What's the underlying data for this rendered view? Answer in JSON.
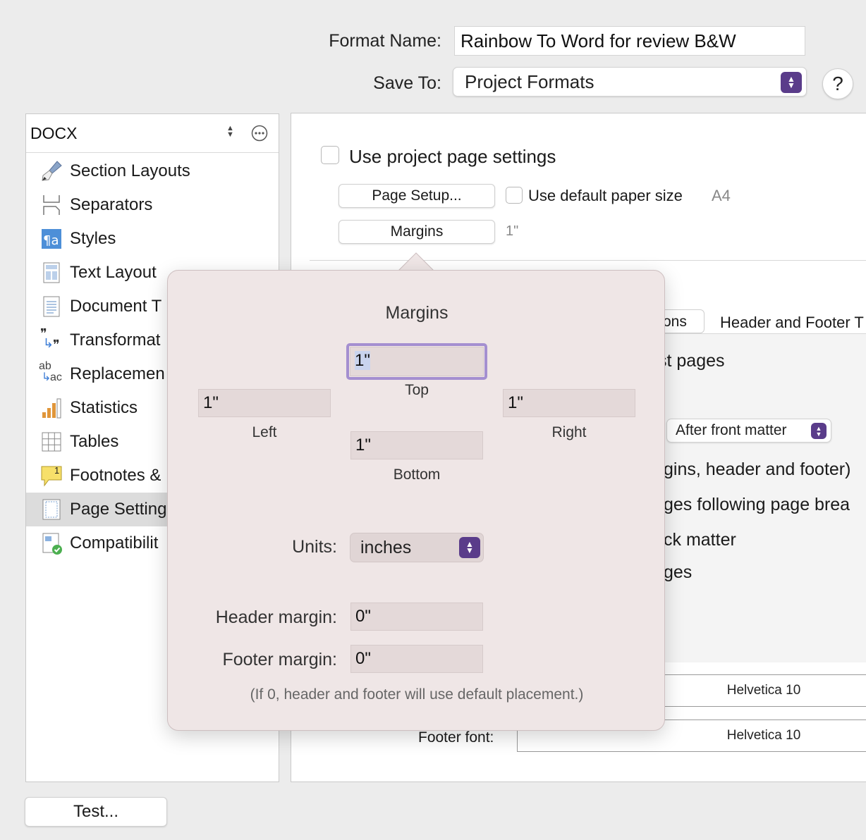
{
  "header": {
    "format_name_label": "Format Name:",
    "format_name_value": "Rainbow To Word for review B&W",
    "save_to_label": "Save To:",
    "save_to_value": "Project Formats",
    "help_label": "?"
  },
  "sidebar": {
    "format_select": "DOCX",
    "items": [
      {
        "label": "Section Layouts",
        "icon": "paintbrush-icon"
      },
      {
        "label": "Separators",
        "icon": "separator-icon"
      },
      {
        "label": "Styles",
        "icon": "styles-icon"
      },
      {
        "label": "Text Layout",
        "icon": "text-layout-icon"
      },
      {
        "label": "Document T",
        "icon": "document-icon"
      },
      {
        "label": "Transformat",
        "icon": "transformations-icon"
      },
      {
        "label": "Replacemen",
        "icon": "replacements-icon"
      },
      {
        "label": "Statistics",
        "icon": "statistics-icon"
      },
      {
        "label": "Tables",
        "icon": "tables-icon"
      },
      {
        "label": "Footnotes &",
        "icon": "footnotes-icon"
      },
      {
        "label": "Page Setting",
        "icon": "page-settings-icon"
      },
      {
        "label": "Compatibilit",
        "icon": "compatibility-icon"
      }
    ],
    "selected_index": 10,
    "footnote_badge": "1",
    "transform_glyph": "❞",
    "replace_ab": "ab",
    "replace_ac": "ac"
  },
  "page_settings": {
    "use_project_label": "Use project page settings",
    "page_setup_button": "Page Setup...",
    "use_default_paper_label": "Use default paper size",
    "paper_size": "A4",
    "margins_button": "Margins",
    "margins_value": "1\"",
    "tab_partial": "ons",
    "tab_header_footer": "Header and Footer T",
    "first_pages_partial": "st pages",
    "after_front_matter": "After front matter",
    "option_margins_partial": "gins, header and footer)",
    "option_pages_partial": "ges following page brea",
    "option_back_matter_partial": "ck matter",
    "option_ges_partial": "ges",
    "header_font_value": "Helvetica 10",
    "footer_font_label": "Footer font:",
    "footer_font_value": "Helvetica 10"
  },
  "margins_popover": {
    "title": "Margins",
    "top_value": "1\"",
    "top_label": "Top",
    "left_value": "1\"",
    "left_label": "Left",
    "right_value": "1\"",
    "right_label": "Right",
    "bottom_value": "1\"",
    "bottom_label": "Bottom",
    "units_label": "Units:",
    "units_value": "inches",
    "header_margin_label": "Header margin:",
    "header_margin_value": "0\"",
    "footer_margin_label": "Footer margin:",
    "footer_margin_value": "0\"",
    "note": "(If 0, header and footer will use default placement.)"
  },
  "footer": {
    "test_button": "Test..."
  },
  "colors": {
    "accent_stepper": "#5a3c8a",
    "selection_focus": "#a48fd0",
    "popover_bg": "#efe6e6"
  }
}
